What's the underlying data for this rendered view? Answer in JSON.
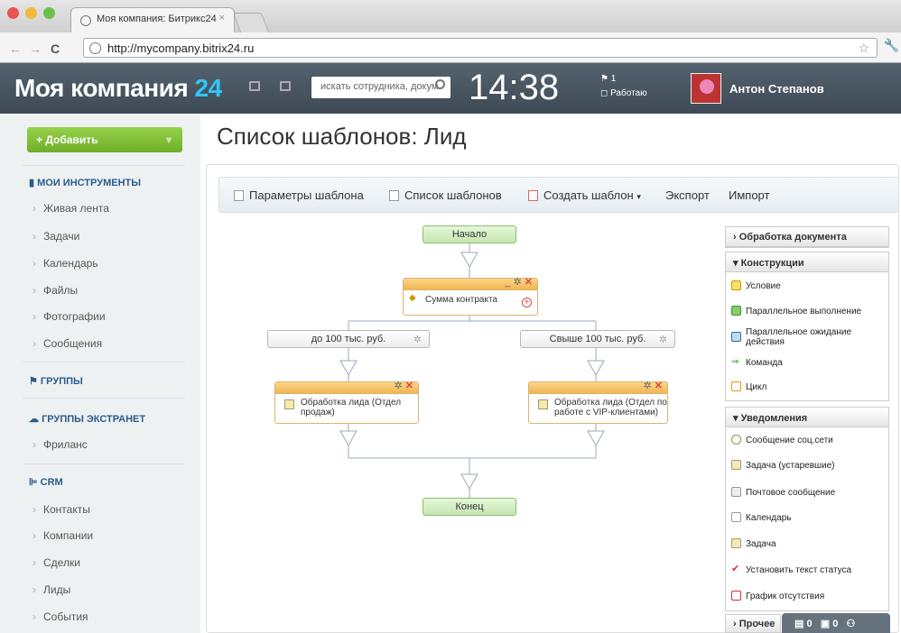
{
  "browser": {
    "tab_title": "Моя компания: Битрикс24",
    "tab_close": "×",
    "url": "http://mycompany.bitrix24.ru"
  },
  "header": {
    "logo_main": "Моя компания",
    "logo_num": "24",
    "search_placeholder": "искать сотрудника, докум",
    "clock": "14:38",
    "status_count": "1",
    "status_label": "Работаю",
    "user_name": "Антон Степанов"
  },
  "sidebar": {
    "add_label": "Добавить",
    "sections": [
      {
        "title": "МОИ ИНСТРУМЕНТЫ",
        "items": [
          "Живая лента",
          "Задачи",
          "Календарь",
          "Файлы",
          "Фотографии",
          "Сообщения"
        ]
      },
      {
        "title": "ГРУППЫ",
        "items": []
      },
      {
        "title": "ГРУППЫ ЭКСТРАНЕТ",
        "items": [
          "Фриланс"
        ]
      },
      {
        "title": "CRM",
        "items": [
          "Контакты",
          "Компании",
          "Сделки",
          "Лиды",
          "События"
        ]
      }
    ]
  },
  "page": {
    "title": "Список шаблонов: Лид"
  },
  "toolbar": {
    "params": "Параметры шаблона",
    "list": "Список шаблонов",
    "create": "Создать шаблон",
    "export": "Экспорт",
    "import": "Импорт"
  },
  "diagram": {
    "start": "Начало",
    "condition": "Сумма контракта",
    "branch_left": "до 100 тыс. руб.",
    "branch_right": "Свыше 100 тыс. руб.",
    "action_left": "Обработка лида (Отдел продаж)",
    "action_right": "Обработка лида (Отдел по работе с VIP-клиентами)",
    "end": "Конец"
  },
  "palette": {
    "doc": "Обработка документа",
    "constructs": "Конструкции",
    "constructs_items": [
      "Условие",
      "Параллельное выполнение",
      "Параллельное ожидание действия",
      "Команда",
      "Цикл"
    ],
    "notify": "Уведомления",
    "notify_items": [
      "Сообщение соц.сети",
      "Задача (устаревшие)",
      "Почтовое сообщение",
      "Календарь",
      "Задача",
      "Установить текст статуса",
      "График отсутствия"
    ],
    "other": "Прочее"
  },
  "bottombar": {
    "msg_count": "0",
    "notif_count": "0"
  }
}
